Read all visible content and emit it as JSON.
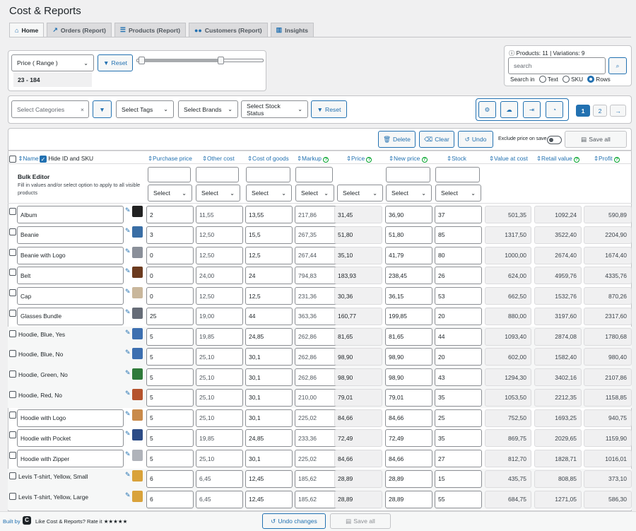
{
  "page": {
    "title": "Cost & Reports"
  },
  "tabs": [
    {
      "label": "Home",
      "icon": "home-icon"
    },
    {
      "label": "Orders (Report)",
      "icon": "chart-line-icon"
    },
    {
      "label": "Products (Report)",
      "icon": "list-icon"
    },
    {
      "label": "Customers (Report)",
      "icon": "users-icon"
    },
    {
      "label": "Insights",
      "icon": "chart-bar-icon"
    }
  ],
  "filter": {
    "price_select": "Price ( Range )",
    "reset_label": "Reset",
    "range_text": "23 - 184",
    "range_min_fraction": 0.04,
    "range_max_fraction": 0.66,
    "categories_placeholder": "Select Categories",
    "tags_label": "Select Tags",
    "brands_label": "Select Brands",
    "stock_label": "Select Stock Status",
    "reset2_label": "Reset"
  },
  "search": {
    "info": "Products: 11 | Variations: 9",
    "placeholder": "search",
    "search_in_label": "Search in",
    "options": [
      "Text",
      "SKU",
      "Rows"
    ],
    "selected": "Rows"
  },
  "pagination": {
    "pages": [
      "1",
      "2"
    ],
    "next": "→",
    "current": "1"
  },
  "toolbar": {
    "delete_label": "Delete",
    "clear_label": "Clear",
    "undo_label": "Undo",
    "exclude_label": "Exclude price on save",
    "save_all_label": "Save all"
  },
  "columns": {
    "name": "Name",
    "hide_id": "Hide ID and SKU",
    "purchase": "Purchase price",
    "other": "Other cost",
    "cog": "Cost of goods",
    "markup": "Markup",
    "price": "Price",
    "new_price": "New price",
    "stock": "Stock",
    "value_cost": "Value at cost",
    "retail": "Retail value",
    "profit": "Profit"
  },
  "bulk": {
    "title": "Bulk Editor",
    "desc": "Fill in values and/or select option to apply to all visible products",
    "select_label": "Select"
  },
  "rows": [
    {
      "name": "Album",
      "purchase": "2",
      "other": "11,55",
      "cog": "13,55",
      "markup": "217,86",
      "price": "31,45",
      "new_price": "36,90",
      "stock": "37",
      "value": "501,35",
      "retail": "1092,24",
      "profit": "590,89"
    },
    {
      "name": "Beanie",
      "purchase": "3",
      "other": "12,50",
      "cog": "15,5",
      "markup": "267,35",
      "price": "51,80",
      "new_price": "51,80",
      "stock": "85",
      "value": "1317,50",
      "retail": "3522,40",
      "profit": "2204,90"
    },
    {
      "name": "Beanie with Logo",
      "purchase": "0",
      "other": "12,50",
      "cog": "12,5",
      "markup": "267,44",
      "price": "35,10",
      "new_price": "41,79",
      "stock": "80",
      "value": "1000,00",
      "retail": "2674,40",
      "profit": "1674,40"
    },
    {
      "name": "Belt",
      "purchase": "0",
      "other": "24,00",
      "cog": "24",
      "markup": "794,83",
      "price": "183,93",
      "new_price": "238,45",
      "stock": "26",
      "value": "624,00",
      "retail": "4959,76",
      "profit": "4335,76"
    },
    {
      "name": "Cap",
      "purchase": "0",
      "other": "12,50",
      "cog": "12,5",
      "markup": "231,36",
      "price": "30,36",
      "new_price": "36,15",
      "stock": "53",
      "value": "662,50",
      "retail": "1532,76",
      "profit": "870,26"
    },
    {
      "name": "Glasses Bundle",
      "purchase": "25",
      "other": "19,00",
      "cog": "44",
      "markup": "363,36",
      "price": "160,77",
      "new_price": "199,85",
      "stock": "20",
      "value": "880,00",
      "retail": "3197,60",
      "profit": "2317,60"
    },
    {
      "name": "Hoodie, Blue, Yes",
      "purchase": "5",
      "other": "19,85",
      "cog": "24,85",
      "markup": "262,86",
      "price": "81,65",
      "new_price": "81,65",
      "stock": "44",
      "value": "1093,40",
      "retail": "2874,08",
      "profit": "1780,68"
    },
    {
      "name": "Hoodie, Blue, No",
      "purchase": "5",
      "other": "25,10",
      "cog": "30,1",
      "markup": "262,86",
      "price": "98,90",
      "new_price": "98,90",
      "stock": "20",
      "value": "602,00",
      "retail": "1582,40",
      "profit": "980,40"
    },
    {
      "name": "Hoodie, Green, No",
      "purchase": "5",
      "other": "25,10",
      "cog": "30,1",
      "markup": "262,86",
      "price": "98,90",
      "new_price": "98,90",
      "stock": "43",
      "value": "1294,30",
      "retail": "3402,16",
      "profit": "2107,86"
    },
    {
      "name": "Hoodie, Red, No",
      "purchase": "5",
      "other": "25,10",
      "cog": "30,1",
      "markup": "210,00",
      "price": "79,01",
      "new_price": "79,01",
      "stock": "35",
      "value": "1053,50",
      "retail": "2212,35",
      "profit": "1158,85"
    },
    {
      "name": "Hoodie with Logo",
      "purchase": "5",
      "other": "25,10",
      "cog": "30,1",
      "markup": "225,02",
      "price": "84,66",
      "new_price": "84,66",
      "stock": "25",
      "value": "752,50",
      "retail": "1693,25",
      "profit": "940,75"
    },
    {
      "name": "Hoodie with Pocket",
      "purchase": "5",
      "other": "19,85",
      "cog": "24,85",
      "markup": "233,36",
      "price": "72,49",
      "new_price": "72,49",
      "stock": "35",
      "value": "869,75",
      "retail": "2029,65",
      "profit": "1159,90"
    },
    {
      "name": "Hoodie with Zipper",
      "purchase": "5",
      "other": "25,10",
      "cog": "30,1",
      "markup": "225,02",
      "price": "84,66",
      "new_price": "84,66",
      "stock": "27",
      "value": "812,70",
      "retail": "1828,71",
      "profit": "1016,01"
    },
    {
      "name": "Levis T-shirt, Yellow, Small",
      "purchase": "6",
      "other": "6,45",
      "cog": "12,45",
      "markup": "185,62",
      "price": "28,89",
      "new_price": "28,89",
      "stock": "15",
      "value": "435,75",
      "retail": "808,85",
      "profit": "373,10"
    },
    {
      "name": "Levis T-shirt, Yellow, Large",
      "purchase": "6",
      "other": "6,45",
      "cog": "12,45",
      "markup": "185,62",
      "price": "28,89",
      "new_price": "28,89",
      "stock": "55",
      "value": "684,75",
      "retail": "1271,05",
      "profit": "586,30"
    }
  ],
  "thumb_colors": [
    "#222222",
    "#3a6ea5",
    "#8a8f99",
    "#6b3b1f",
    "#c9b79c",
    "#666c77",
    "#3d6fb0",
    "#3d6fb0",
    "#2f7a3a",
    "#b5532d",
    "#c98a4a",
    "#2c4b86",
    "#b0b3ba",
    "#d9a23b",
    "#d9a23b"
  ],
  "footer": {
    "built_by": "Built by",
    "rate_text": "Like Cost & Reports? Rate it ★★★★★",
    "undo_changes": "Undo changes",
    "save_all": "Save all"
  }
}
